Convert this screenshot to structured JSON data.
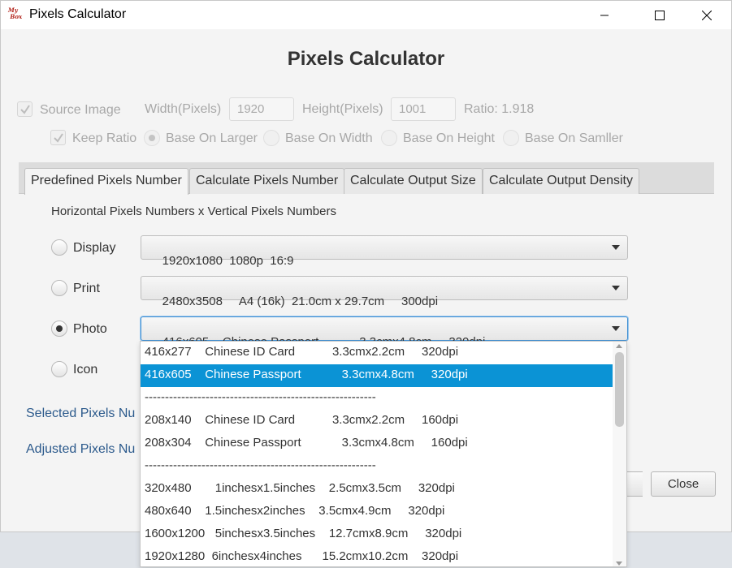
{
  "window": {
    "title": "Pixels Calculator",
    "logo_text": "My Box"
  },
  "heading": "Pixels Calculator",
  "source": {
    "checkbox_label": "Source Image",
    "width_label": "Width(Pixels)",
    "width_value": "1920",
    "height_label": "Height(Pixels)",
    "height_value": "1001",
    "ratio": "Ratio: 1.918",
    "keep_ratio_label": "Keep Ratio",
    "base_options": [
      "Base On Larger",
      "Base On Width",
      "Base On Height",
      "Base On Samller"
    ]
  },
  "tabs": [
    {
      "label": "Predefined Pixels Number"
    },
    {
      "label": "Calculate Pixels Number"
    },
    {
      "label": "Calculate Output Size"
    },
    {
      "label": "Calculate Output Density"
    }
  ],
  "predefined": {
    "description": "Horizontal Pixels Numbers x Vertical Pixels Numbers",
    "rows": [
      {
        "label": "Display",
        "value": "1920x1080  1080p  16:9"
      },
      {
        "label": "Print",
        "value": "2480x3508     A4 (16k)  21.0cm x 29.7cm     300dpi"
      },
      {
        "label": "Photo",
        "value": "416x605    Chinese Passport            3.3cmx4.8cm     320dpi"
      },
      {
        "label": "Icon",
        "value": ""
      }
    ],
    "selected_label": "Selected Pixels Nu",
    "adjusted_label": "Adjusted Pixels Nu"
  },
  "dropdown_options": [
    "416x277    Chinese ID Card           3.3cmx2.2cm     320dpi",
    "416x605    Chinese Passport            3.3cmx4.8cm     320dpi",
    "---------------------------------------------------------",
    "208x140    Chinese ID Card           3.3cmx2.2cm     160dpi",
    "208x304    Chinese Passport            3.3cmx4.8cm     160dpi",
    "---------------------------------------------------------",
    "320x480       1inchesx1.5inches    2.5cmx3.5cm     320dpi",
    "480x640    1.5inchesx2inches    3.5cmx4.9cm     320dpi",
    "1600x1200   5inchesx3.5inches    12.7cmx8.9cm     320dpi",
    "1920x1280  6inchesx4inches      15.2cmx10.2cm    320dpi"
  ],
  "buttons": {
    "close": "Close"
  },
  "colors": {
    "selection": "#0b93d5",
    "focus": "#3f8fd2",
    "link": "#2c5a8c"
  }
}
